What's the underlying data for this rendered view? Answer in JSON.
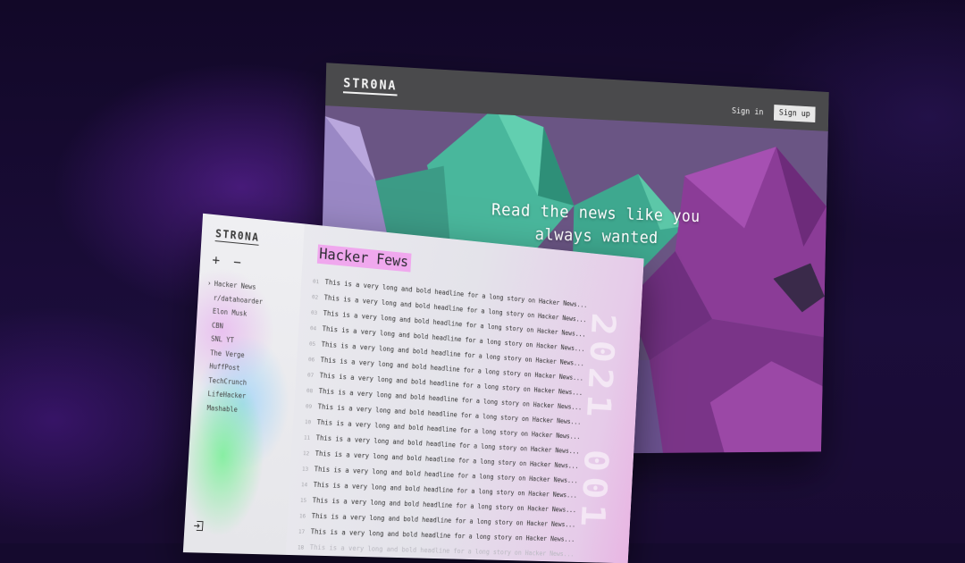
{
  "landing": {
    "logo": "STR0NA",
    "sign_in": "Sign in",
    "sign_up": "Sign up",
    "tagline_line1": "Read the news like you",
    "tagline_line2": "always wanted"
  },
  "reader": {
    "logo": "STR0NA",
    "add_label": "+",
    "remove_label": "−",
    "sources": [
      {
        "label": "Hacker News",
        "marker": "›"
      },
      {
        "label": "r/datahoarder",
        "marker": ""
      },
      {
        "label": "Elon Musk",
        "marker": ""
      },
      {
        "label": "CBN",
        "marker": ""
      },
      {
        "label": "SNL YT",
        "marker": ""
      },
      {
        "label": "The Verge",
        "marker": ""
      },
      {
        "label": "HuffPost",
        "marker": ""
      },
      {
        "label": "TechCrunch",
        "marker": ""
      },
      {
        "label": "LifeHacker",
        "marker": ""
      },
      {
        "label": "Mashable",
        "marker": ""
      }
    ],
    "title": "Hacker Fews",
    "date_watermark": "2021 001",
    "headlines": [
      {
        "num": "01",
        "text": "This is a  very long and bold headline for a long story on Hacker News..."
      },
      {
        "num": "02",
        "text": "This is a  very long and bold headline for a long story on Hacker News..."
      },
      {
        "num": "03",
        "text": "This is a  very long and bold headline for a long story on Hacker News..."
      },
      {
        "num": "04",
        "text": "This is a  very long and bold headline for a long story on Hacker News..."
      },
      {
        "num": "05",
        "text": "This is a  very long and bold headline for a long story on Hacker News..."
      },
      {
        "num": "06",
        "text": "This is a  very long and bold headline for a long story on Hacker News..."
      },
      {
        "num": "07",
        "text": "This is a  very long and bold headline for a long story on Hacker News..."
      },
      {
        "num": "08",
        "text": "This is a  very long and bold headline for a long story on Hacker News..."
      },
      {
        "num": "09",
        "text": "This is a  very long and bold headline for a long story on Hacker News..."
      },
      {
        "num": "10",
        "text": "This is a  very long and bold headline for a long story on Hacker News..."
      },
      {
        "num": "11",
        "text": "This is a  very long and bold headline for a long story on Hacker News..."
      },
      {
        "num": "12",
        "text": "This is a  very long and bold headline for a long story on Hacker News..."
      },
      {
        "num": "13",
        "text": "This is a  very long and bold headline for a long story on Hacker News..."
      },
      {
        "num": "14",
        "text": "This is a  very long and bold headline for a long story on Hacker News..."
      },
      {
        "num": "15",
        "text": "This is a  very long and bold headline for a long story on Hacker News..."
      },
      {
        "num": "16",
        "text": "This is a  very long and bold headline for a long story on Hacker News..."
      },
      {
        "num": "17",
        "text": "This is a  very long and bold headline for a long story on Hacker News..."
      },
      {
        "num": "18",
        "text": "This is a  very long and bold headline for a long story on Hacker News..."
      }
    ]
  },
  "icons": {
    "exit": "exit-icon"
  },
  "colors": {
    "background": "#150a2e",
    "accent_pink": "#f0a8ee",
    "mountain_teal": "#3fb59a",
    "mountain_purple": "#8a3f93"
  }
}
